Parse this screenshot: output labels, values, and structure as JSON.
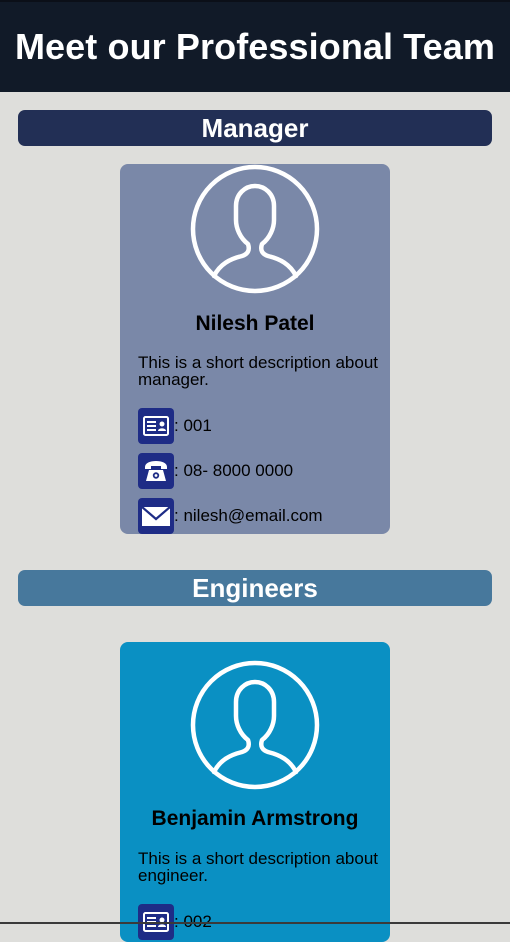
{
  "header": {
    "title": "Meet our Professional Team"
  },
  "sections": {
    "manager": {
      "title": "Manager"
    },
    "engineers": {
      "title": "Engineers"
    }
  },
  "manager_card": {
    "avatar_icon": "user-silhouette-icon",
    "name": "Nilesh Patel",
    "description": "This is a short description about manager.",
    "id_icon": "id-card-icon",
    "id": ": 001",
    "phone_icon": "telephone-icon",
    "phone": ": 08- 8000 0000",
    "email_icon": "envelope-icon",
    "email": ": nilesh@email.com"
  },
  "engineer_card": {
    "avatar_icon": "user-silhouette-icon",
    "name": "Benjamin Armstrong",
    "description": "This is a short description about engineer.",
    "id_icon": "id-card-icon",
    "id": ": 002"
  },
  "colors": {
    "header_bg": "#111a28",
    "manager_bar": "#222f55",
    "engineers_bar": "#47789c",
    "manager_card": "#7a88a8",
    "engineer_card": "#0a90c3",
    "icon_bg": "#1e2c86",
    "page_bg": "#dededb"
  }
}
